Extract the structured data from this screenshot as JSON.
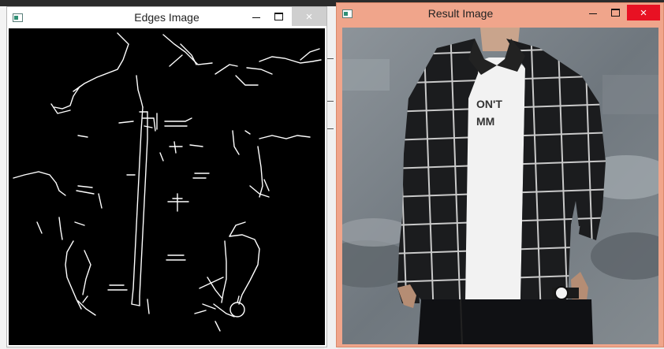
{
  "edges_window": {
    "title": "Edges Image",
    "icon": "window-app-icon",
    "controls": {
      "minimize": "minimize-icon",
      "maximize": "maximize-icon",
      "close": "×"
    }
  },
  "result_window": {
    "title": "Result Image",
    "icon": "window-app-icon",
    "controls": {
      "minimize": "minimize-icon",
      "maximize": "maximize-icon",
      "close": "×"
    }
  },
  "shirt_print": [
    "ON'T",
    "MM"
  ],
  "colors": {
    "result_frame": "#f0a58b",
    "close_active": "#e81123",
    "close_inactive": "#cfcfcf",
    "edge_line": "#ffffff",
    "shirt": "#1c1c1e",
    "shirt_grid": "#d0d0d0"
  }
}
